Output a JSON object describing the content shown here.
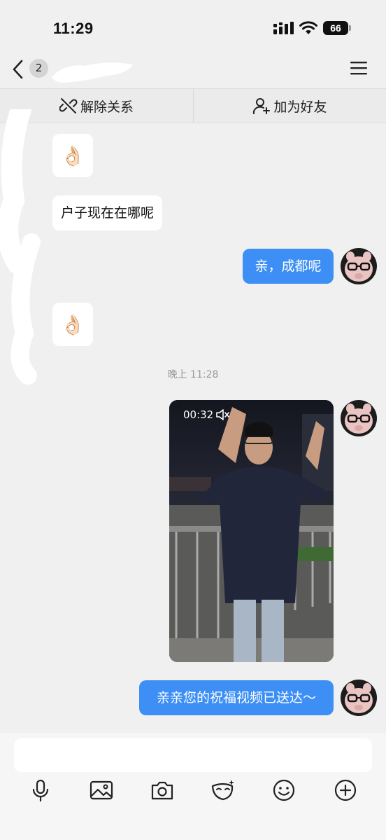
{
  "status_bar": {
    "time": "11:29",
    "battery": "66"
  },
  "nav": {
    "unread_count": "2"
  },
  "actions": {
    "unlink_label": "解除关系",
    "add_friend_label": "加为好友"
  },
  "messages": [
    {
      "side": "in",
      "type": "emoji",
      "text": "👌🏻"
    },
    {
      "side": "in",
      "type": "text",
      "text": "户子现在在哪呢"
    },
    {
      "side": "out",
      "type": "text",
      "text": "亲，成都呢"
    },
    {
      "side": "in",
      "type": "emoji",
      "text": "👌🏻"
    },
    {
      "side": "out",
      "type": "video",
      "duration": "00:32"
    },
    {
      "side": "out",
      "type": "text",
      "text": "亲亲您的祝福视频已送达～"
    }
  ],
  "timestamp": "晚上 11:28",
  "colors": {
    "outgoing_bubble": "#3d8ff5",
    "background": "#f0f0f0"
  },
  "toolbar": {
    "icons": [
      "microphone-icon",
      "image-icon",
      "camera-icon",
      "mask-icon",
      "emoji-icon",
      "plus-icon"
    ]
  }
}
